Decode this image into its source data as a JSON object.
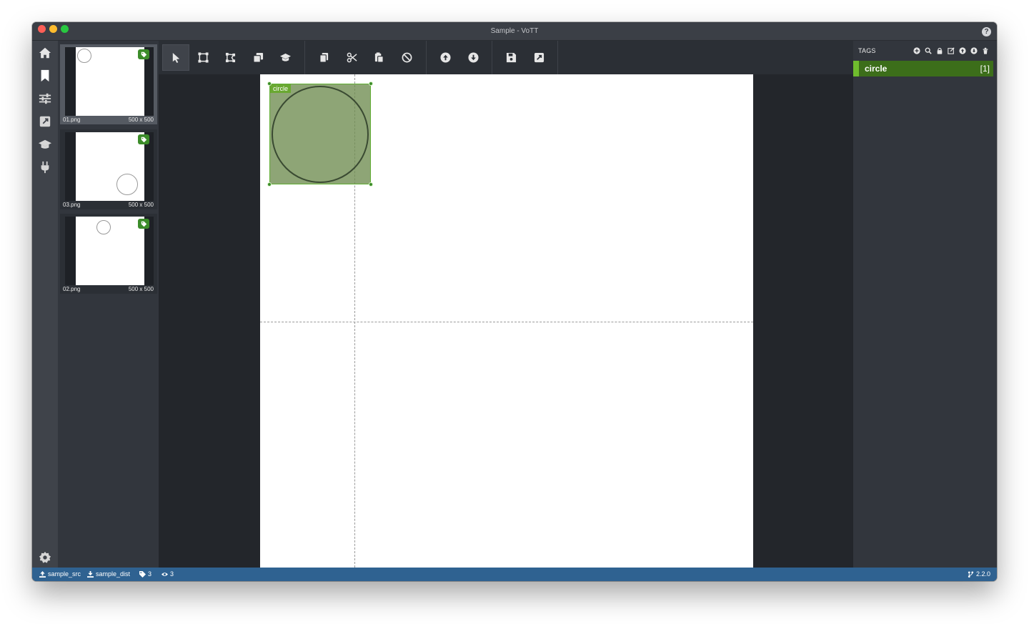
{
  "window": {
    "title": "Sample - VoTT",
    "help_icon": "question-circle-icon"
  },
  "app_sidebar": {
    "items": [
      {
        "name": "home",
        "icon": "home-icon"
      },
      {
        "name": "tag-editor",
        "icon": "bookmark-icon"
      },
      {
        "name": "project-settings",
        "icon": "sliders-icon"
      },
      {
        "name": "export",
        "icon": "external-link-icon"
      },
      {
        "name": "active-learning",
        "icon": "graduation-cap-icon"
      },
      {
        "name": "connections",
        "icon": "plug-icon"
      }
    ],
    "settings_icon": "gear-icon"
  },
  "thumbnails": [
    {
      "name": "01.png",
      "size": "500 x 500",
      "active": true
    },
    {
      "name": "03.png",
      "size": "500 x 500",
      "active": false
    },
    {
      "name": "02.png",
      "size": "500 x 500",
      "active": false
    }
  ],
  "toolbar": {
    "groups": [
      [
        "select-icon",
        "draw-rectangle-icon",
        "draw-polygon-icon",
        "copy-rectangle-icon",
        "active-learning-icon"
      ],
      [
        "copy-regions-icon",
        "cut-regions-icon",
        "paste-regions-icon",
        "clear-regions-icon"
      ],
      [
        "previous-asset-icon",
        "next-asset-icon"
      ],
      [
        "save-project-icon",
        "export-project-icon"
      ]
    ]
  },
  "canvas": {
    "region": {
      "tag": "circle"
    }
  },
  "tags_panel": {
    "header": "TAGS",
    "actions": [
      "add-tag-icon",
      "search-tags-icon",
      "lock-tags-icon",
      "edit-tag-icon",
      "move-tag-up-icon",
      "move-tag-down-icon",
      "delete-tag-icon"
    ],
    "tags": [
      {
        "name": "circle",
        "count": "[1]",
        "color": "#6fbc2e"
      }
    ]
  },
  "statusbar": {
    "source": "sample_src",
    "target": "sample_dist",
    "tag_count": "3",
    "visited_count": "3",
    "version": "2.2.0"
  },
  "colors": {
    "statusbar": "#2f6291",
    "tag_accent": "#6fbc2e",
    "region_fill": "#6e8c50"
  }
}
